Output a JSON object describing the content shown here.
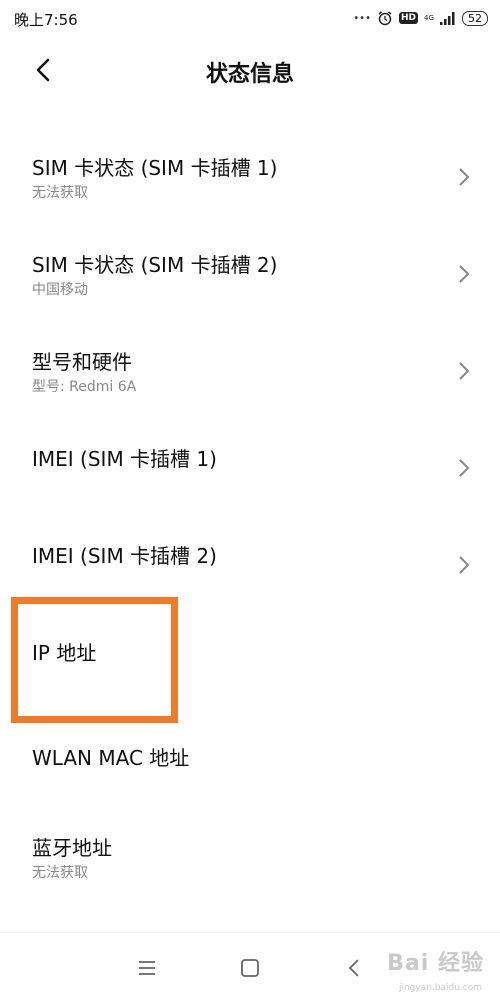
{
  "status_bar": {
    "time": "晚上7:56",
    "hd_label": "HD",
    "network_label": "4G",
    "battery": "52"
  },
  "header": {
    "title": "状态信息"
  },
  "items": [
    {
      "title": "SIM 卡状态 (SIM 卡插槽 1)",
      "subtitle": "无法获取"
    },
    {
      "title": "SIM 卡状态 (SIM 卡插槽 2)",
      "subtitle": "中国移动"
    },
    {
      "title": "型号和硬件",
      "subtitle": "型号: Redmi 6A"
    },
    {
      "title": "IMEI (SIM 卡插槽 1)",
      "subtitle": ""
    },
    {
      "title": "IMEI (SIM 卡插槽 2)",
      "subtitle": ""
    },
    {
      "title": "IP 地址",
      "subtitle": ""
    },
    {
      "title": "WLAN MAC 地址",
      "subtitle": ""
    },
    {
      "title": "蓝牙地址",
      "subtitle": "无法获取"
    }
  ],
  "highlight_color": "#f07a2b",
  "watermark": {
    "text": "Bai 经验",
    "url": "jingyan.baidu.com"
  }
}
